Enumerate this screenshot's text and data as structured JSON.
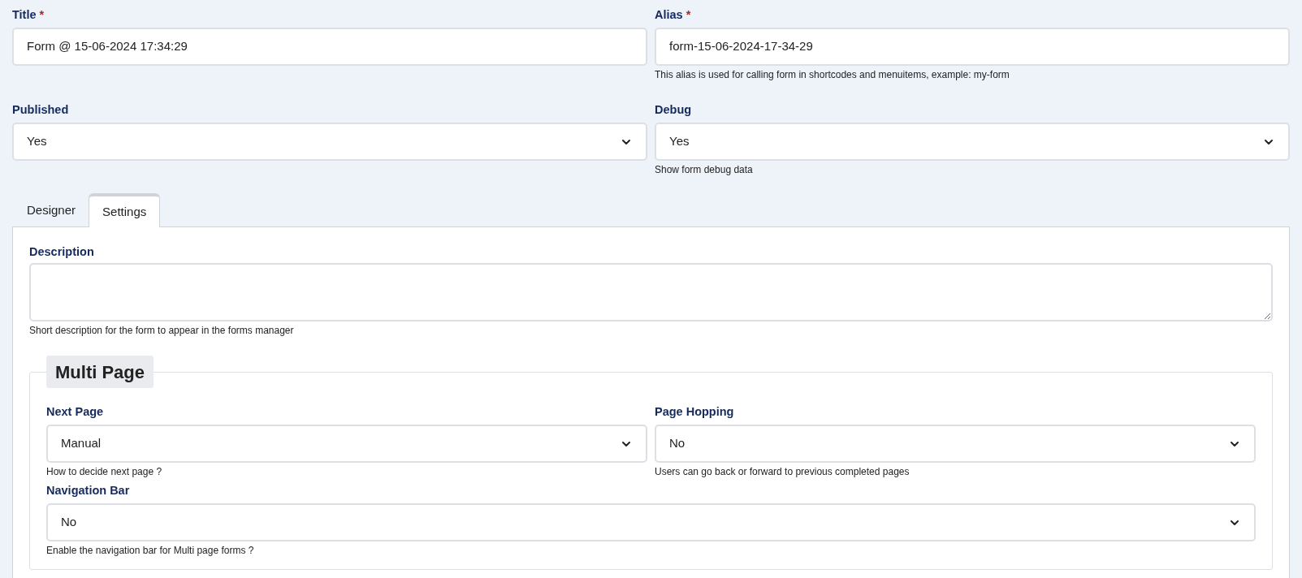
{
  "top_fields": [
    {
      "label": "Title",
      "required_mark": "*",
      "kind": "text",
      "value": "Form @ 15-06-2024 17:34:29"
    },
    {
      "label": "Alias",
      "required_mark": "*",
      "kind": "text",
      "value": "form-15-06-2024-17-34-29",
      "help": "This alias is used for calling form in shortcodes and menuitems, example: my-form"
    },
    {
      "label": "Published",
      "kind": "select",
      "value": "Yes"
    },
    {
      "label": "Debug",
      "kind": "select",
      "value": "Yes",
      "help": "Show form debug data"
    }
  ],
  "tabs": [
    {
      "label": "Designer",
      "selected": false
    },
    {
      "label": "Settings",
      "selected": true
    }
  ],
  "description": {
    "label": "Description",
    "help": "Short description for the form to appear in the forms manager"
  },
  "multi_page": {
    "legend": "Multi Page",
    "rows": [
      [
        {
          "label": "Next Page",
          "kind": "select",
          "value": "Manual",
          "help": "How to decide next page ?"
        },
        {
          "label": "Page Hopping",
          "kind": "select",
          "value": "No",
          "help": "Users can go back or forward to previous completed pages"
        }
      ],
      [
        {
          "label": "Navigation Bar",
          "kind": "select",
          "value": "No",
          "help": "Enable the navigation bar for Multi page forms ?"
        }
      ]
    ]
  }
}
